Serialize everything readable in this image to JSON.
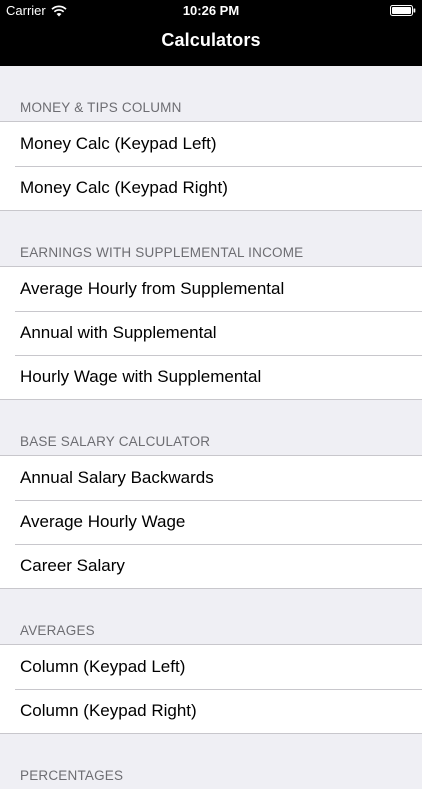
{
  "status_bar": {
    "carrier": "Carrier",
    "time": "10:26 PM"
  },
  "nav": {
    "title": "Calculators"
  },
  "sections": [
    {
      "header": "MONEY & TIPS COLUMN",
      "rows": [
        "Money Calc (Keypad Left)",
        "Money Calc (Keypad Right)"
      ]
    },
    {
      "header": "EARNINGS WITH SUPPLEMENTAL INCOME",
      "rows": [
        "Average Hourly from Supplemental",
        "Annual with Supplemental",
        "Hourly Wage with Supplemental"
      ]
    },
    {
      "header": "BASE SALARY CALCULATOR",
      "rows": [
        "Annual Salary Backwards",
        "Average Hourly Wage",
        "Career Salary"
      ]
    },
    {
      "header": "AVERAGES",
      "rows": [
        "Column (Keypad Left)",
        "Column (Keypad Right)"
      ]
    },
    {
      "header": "PERCENTAGES",
      "rows": []
    }
  ]
}
